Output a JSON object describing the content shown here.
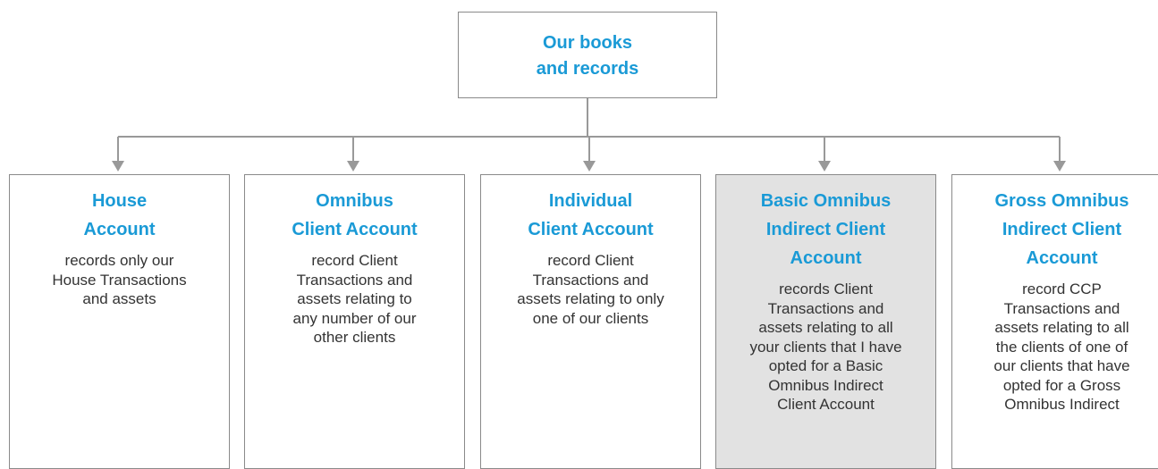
{
  "root": {
    "title_line1": "Our books",
    "title_line2": "and records"
  },
  "accounts": [
    {
      "title": [
        "House",
        "Account"
      ],
      "desc": [
        "records only our",
        "House Transactions",
        "and assets"
      ]
    },
    {
      "title": [
        "Omnibus",
        "Client Account"
      ],
      "desc": [
        "record Client",
        "Transactions and",
        "assets relating to",
        "any number of our",
        "other clients"
      ]
    },
    {
      "title": [
        "Individual",
        "Client Account"
      ],
      "desc": [
        "record Client",
        "Transactions and",
        "assets relating to only",
        "one of our clients"
      ]
    },
    {
      "title": [
        "Basic Omnibus",
        "Indirect Client",
        "Account"
      ],
      "desc": [
        "records Client",
        "Transactions and",
        "assets relating to all",
        "your clients that I have",
        "opted for a Basic",
        "Omnibus Indirect",
        "Client Account"
      ]
    },
    {
      "title": [
        "Gross Omnibus",
        "Indirect Client",
        "Account"
      ],
      "desc": [
        "record CCP",
        "Transactions and",
        "assets relating to all",
        "the clients of one of",
        "our clients that have",
        "opted for a Gross",
        "Omnibus Indirect"
      ]
    }
  ],
  "colors": {
    "title": "#1a9ad6",
    "text": "#333333",
    "border": "#8a8a8a",
    "connector": "#999999",
    "highlight_fill": "#e2e2e2"
  }
}
